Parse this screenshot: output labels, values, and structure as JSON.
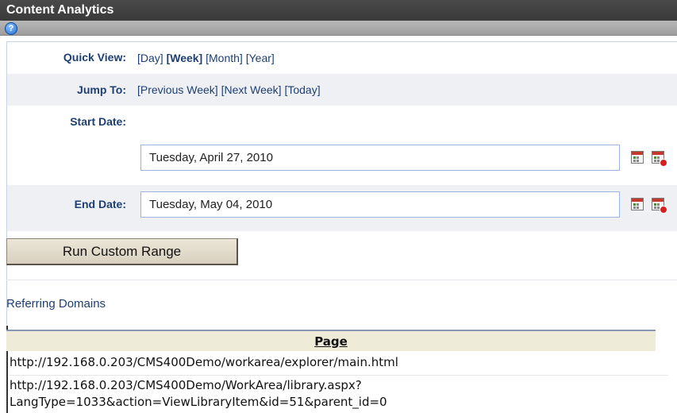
{
  "header": {
    "title": "Content Analytics"
  },
  "toolbar": {
    "help_icon": "help-icon",
    "help_glyph": "?"
  },
  "quick_view": {
    "label": "Quick View:",
    "options": [
      "[Day]",
      "[Week]",
      "[Month]",
      "[Year]"
    ],
    "active": "[Week]"
  },
  "jump_to": {
    "label": "Jump To:",
    "options": [
      "[Previous Week]",
      "[Next Week]",
      "[Today]"
    ]
  },
  "start_date": {
    "label": "Start Date:",
    "value": "Tuesday, April 27, 2010"
  },
  "end_date": {
    "label": "End Date:",
    "value": "Tuesday, May 04, 2010"
  },
  "run_button": {
    "label": "Run Custom Range"
  },
  "report": {
    "title": "Referring Domains",
    "column_header": "Page",
    "rows": [
      "http://192.168.0.203/CMS400Demo/workarea/explorer/main.html",
      "http://192.168.0.203/CMS400Demo/WorkArea/library.aspx?",
      "LangType=1033&action=ViewLibraryItem&id=51&parent_id=0"
    ]
  },
  "colors": {
    "label_blue": "#1d3f73",
    "titlebar": "#3f3f3f",
    "input_border": "#9ab6de"
  }
}
